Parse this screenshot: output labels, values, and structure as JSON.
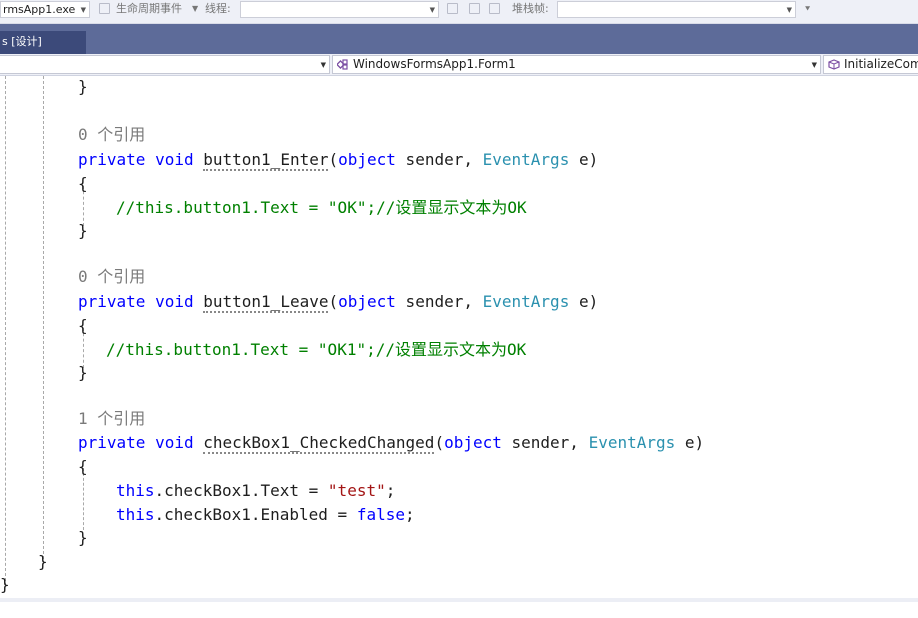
{
  "toolbar": {
    "process_text": "rmsApp1.exe",
    "lifecycle_label": "生命周期事件",
    "thread_label": "线程:",
    "stackframe_label": "堆栈帧:"
  },
  "tabs": [
    {
      "label": "s [设计]",
      "active": true
    }
  ],
  "navbar": {
    "left_value": "",
    "middle_value": "WindowsFormsApp1.Form1",
    "right_value": "InitializeCom"
  },
  "code": {
    "l0_close": "}",
    "m1_refs": "0 个引用",
    "m1_private": "private",
    "m1_void": "void",
    "m1_name": "button1_Enter",
    "m1_paren_open": "(",
    "m1_object": "object",
    "m1_sender": " sender, ",
    "m1_type": "EventArgs",
    "m1_e": " e)",
    "m1_open": "{",
    "m1_body": "//this.button1.Text = \"OK\";//设置显示文本为OK",
    "m1_close": "}",
    "m2_refs": "0 个引用",
    "m2_private": "private",
    "m2_void": "void",
    "m2_name": "button1_Leave",
    "m2_paren_open": "(",
    "m2_object": "object",
    "m2_sender": " sender, ",
    "m2_type": "EventArgs",
    "m2_e": " e)",
    "m2_open": "{",
    "m2_body": "//this.button1.Text = \"OK1\";//设置显示文本为OK",
    "m2_close": "}",
    "m3_refs": "1 个引用",
    "m3_private": "private",
    "m3_void": "void",
    "m3_name": "checkBox1_CheckedChanged",
    "m3_paren_open": "(",
    "m3_object": "object",
    "m3_sender": " sender, ",
    "m3_type": "EventArgs",
    "m3_e": " e)",
    "m3_open": "{",
    "m3_b1_this": "this",
    "m3_b1_mid": ".checkBox1.Text = ",
    "m3_b1_str": "\"test\"",
    "m3_b1_end": ";",
    "m3_b2_this": "this",
    "m3_b2_mid": ".checkBox1.Enabled = ",
    "m3_b2_false": "false",
    "m3_b2_end": ";",
    "m3_close": "}",
    "class_close": "}",
    "ns_close": "}"
  }
}
